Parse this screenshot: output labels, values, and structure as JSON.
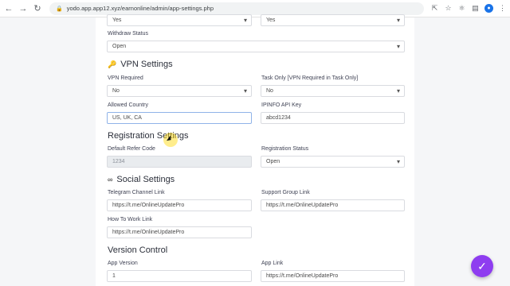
{
  "browser": {
    "url": "yodo.app.app12.xyz/earnonline/admin/app-settings.php",
    "back_icon": "arrow-left",
    "forward_icon": "arrow-right",
    "reload_icon": "reload",
    "lock_icon": "lock"
  },
  "top": {
    "field_left_value": "Yes",
    "field_right_value": "Yes",
    "withdraw_status_label": "Withdraw Status",
    "withdraw_status_value": "Open"
  },
  "vpn": {
    "title": "VPN Settings",
    "icon": "key-icon",
    "vpn_required_label": "VPN Required",
    "vpn_required_value": "No",
    "task_only_label": "Task Only [VPN Required in Task Only]",
    "task_only_value": "No",
    "allowed_country_label": "Allowed Country",
    "allowed_country_value": "US, UK, CA",
    "ipinfo_label": "IPINFO API Key",
    "ipinfo_value": "abcd1234"
  },
  "registration": {
    "title": "Registration Settings",
    "default_refer_label": "Default Refer Code",
    "default_refer_value": "1234",
    "status_label": "Registration Status",
    "status_value": "Open"
  },
  "social": {
    "title": "Social Settings",
    "icon": "link-icon",
    "telegram_label": "Telegram Channel Link",
    "telegram_value": "https://t.me/OnlineUpdatePro",
    "support_label": "Support Group Link",
    "support_value": "https://t.me/OnlineUpdatePro",
    "howto_label": "How To Work Link",
    "howto_value": "https://t.me/OnlineUpdatePro"
  },
  "version": {
    "title": "Version Control",
    "app_version_label": "App Version",
    "app_version_value": "1",
    "app_link_label": "App Link",
    "app_link_value": "https://t.me/OnlineUpdatePro"
  },
  "fab": {
    "icon": "check-icon",
    "color": "#8e3df0"
  }
}
